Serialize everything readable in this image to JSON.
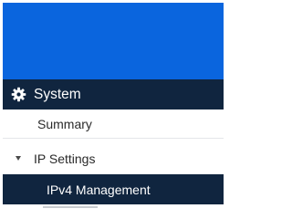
{
  "sidebar": {
    "section": {
      "icon": "gear-icon",
      "label": "System"
    },
    "items": [
      {
        "label": "Summary",
        "active": false
      },
      {
        "label": "IP Settings",
        "expanded": true,
        "icon": "expand-triangle-icon"
      },
      {
        "label": "IPv4 Management",
        "active": true
      }
    ]
  },
  "colors": {
    "banner": "#0a65de",
    "nav_dark": "#10253f",
    "text": "#2a2a2a"
  }
}
